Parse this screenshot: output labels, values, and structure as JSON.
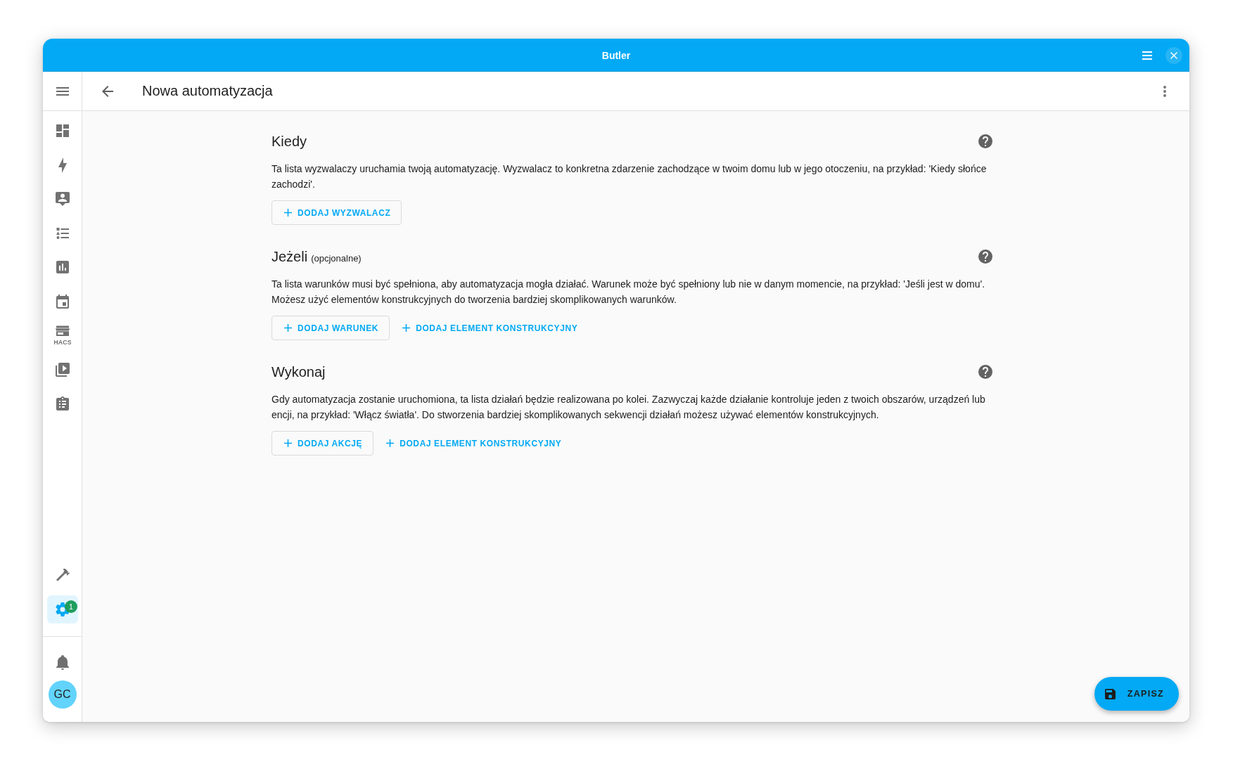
{
  "window": {
    "title": "Butler"
  },
  "sidebar": {
    "items": [
      {
        "selected": false
      },
      {
        "selected": false
      },
      {
        "selected": false
      },
      {
        "selected": false
      },
      {
        "selected": false
      },
      {
        "selected": false
      },
      {
        "selected": false,
        "logo_text": "HACS"
      },
      {
        "selected": false
      },
      {
        "selected": false
      }
    ],
    "bottom_items": [
      {
        "selected": false
      },
      {
        "selected": true,
        "badge": "1"
      }
    ],
    "user": {
      "initials": "GC"
    }
  },
  "header": {
    "title": "Nowa automatyzacja"
  },
  "sections": [
    {
      "title": "Kiedy",
      "description": "Ta lista wyzwalaczy uruchamia twoją automatyzację. Wyzwalacz to konkretna zdarzenie zachodzące w twoim domu lub w jego otoczeniu, na przykład: 'Kiedy słońce zachodzi'.",
      "buttons": [
        {
          "kind": "outlined",
          "label": "DODAJ WYZWALACZ"
        }
      ]
    },
    {
      "title": "Jeżeli",
      "note": "(opcjonalne)",
      "description": "Ta lista warunków musi być spełniona, aby automatyzacja mogła działać. Warunek może być spełniony lub nie w danym momencie, na przykład: 'Jeśli jest w domu'. Możesz użyć elementów konstrukcyjnych do tworzenia bardziej skomplikowanych warunków.",
      "buttons": [
        {
          "kind": "outlined",
          "label": "DODAJ WARUNEK"
        },
        {
          "kind": "text",
          "label": "DODAJ ELEMENT KONSTRUKCYJNY"
        }
      ]
    },
    {
      "title": "Wykonaj",
      "description": "Gdy automatyzacja zostanie uruchomiona, ta lista działań będzie realizowana po kolei. Zazwyczaj każde działanie kontroluje jeden z twoich obszarów, urządzeń lub encji, na przykład: 'Włącz światła'. Do stworzenia bardziej skomplikowanych sekwencji działań możesz używać elementów konstrukcyjnych.",
      "buttons": [
        {
          "kind": "outlined",
          "label": "DODAJ AKCJĘ"
        },
        {
          "kind": "text",
          "label": "DODAJ ELEMENT KONSTRUKCYJNY"
        }
      ]
    }
  ],
  "save_button": {
    "label": "ZAPISZ"
  }
}
